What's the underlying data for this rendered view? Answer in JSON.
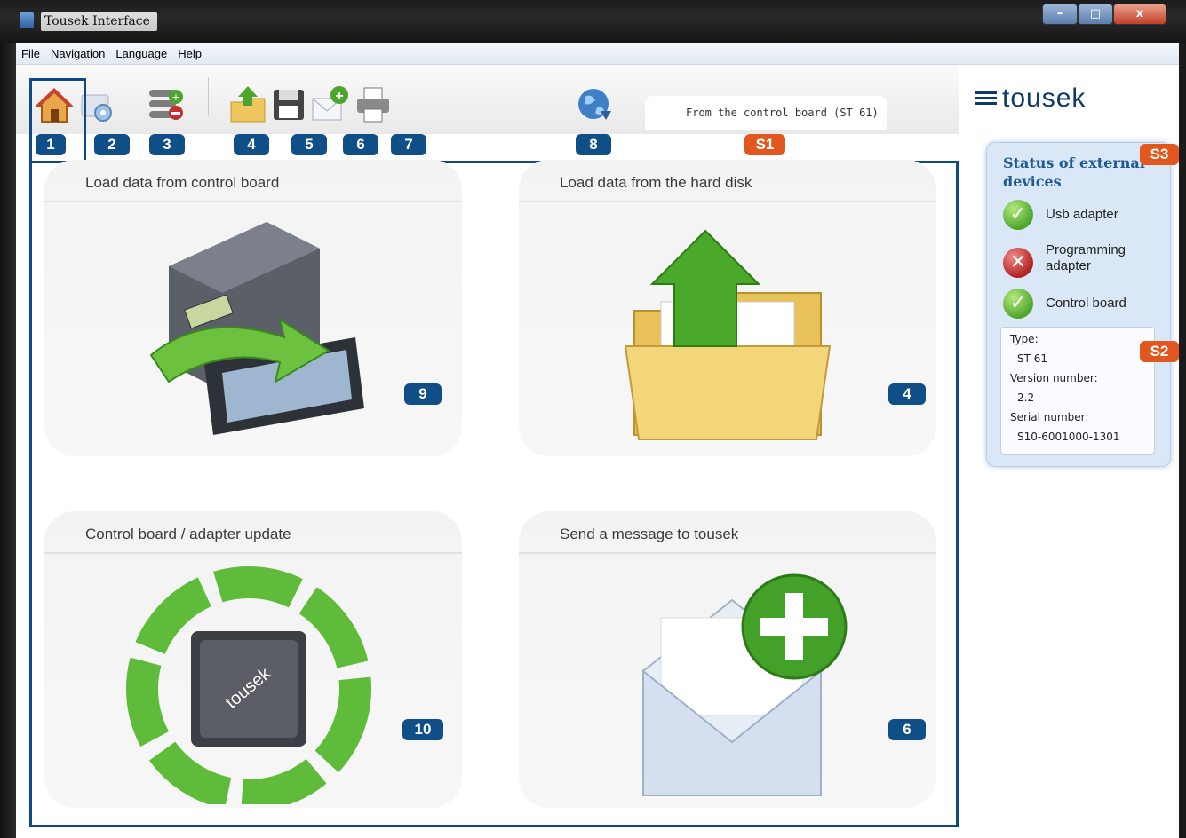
{
  "window": {
    "title": "Tousek Interface",
    "minimize": "–",
    "maximize": "□",
    "close": "x"
  },
  "menu": [
    "File",
    "Navigation",
    "Language",
    "Help"
  ],
  "toolbar": {
    "badges": [
      "1",
      "2",
      "3",
      "4",
      "5",
      "6",
      "7",
      "8"
    ],
    "icons": [
      "home-icon",
      "settings-icon",
      "add-remove-icon",
      "upload-folder-icon",
      "save-disk-icon",
      "new-message-icon",
      "print-icon",
      "globe-icon"
    ],
    "source_label": "From the control board (ST 61)",
    "source_badge": "S1"
  },
  "main": {
    "panels": [
      {
        "title": "Load data from control board",
        "badge": "9"
      },
      {
        "title": "Load data from the hard disk",
        "badge": "4"
      },
      {
        "title": "Control board / adapter update",
        "badge": "10"
      },
      {
        "title": "Send a message to tousek",
        "badge": "6"
      }
    ]
  },
  "brand": {
    "name": "tousek"
  },
  "status": {
    "badge": "S3",
    "title": "Status of external devices",
    "devices": [
      {
        "label": "Usb adapter",
        "state": "ok"
      },
      {
        "label": "Programming adapter",
        "state": "error"
      },
      {
        "label": "Control board",
        "state": "ok"
      }
    ],
    "info_badge": "S2",
    "type_label": "Type:",
    "type_value": "ST 61",
    "version_label": "Version number:",
    "version_value": "2.2",
    "serial_label": "Serial number:",
    "serial_value": "S10-6001000-1301"
  },
  "colors": {
    "badge_blue": "#0f4e86",
    "badge_orange": "#e2571e",
    "highlight": "#0e4b85",
    "brand": "#0f3a68"
  }
}
